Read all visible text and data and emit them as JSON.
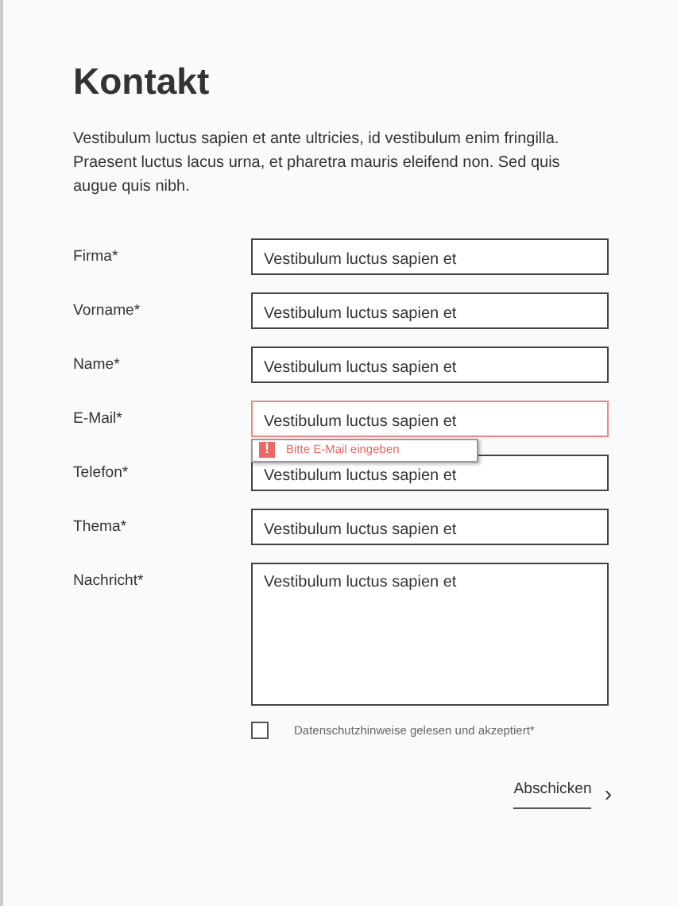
{
  "title": "Kontakt",
  "intro": "Vestibulum luctus sapien et ante ultricies, id vestibulum enim fringilla. Praesent luctus lacus urna, et pharetra mauris eleifend non. Sed quis augue quis nibh.",
  "fields": [
    {
      "label": "Firma*",
      "value": "Vestibulum luctus sapien et",
      "kind": "input",
      "invalid": false
    },
    {
      "label": "Vorname*",
      "value": "Vestibulum luctus sapien et",
      "kind": "input",
      "invalid": false
    },
    {
      "label": "Name*",
      "value": "Vestibulum luctus sapien et",
      "kind": "input",
      "invalid": false
    },
    {
      "label": "E-Mail*",
      "value": "Vestibulum luctus sapien et",
      "kind": "input",
      "invalid": true,
      "error": "Bitte E-Mail eingeben",
      "error_icon": "!"
    },
    {
      "label": "Telefon*",
      "value": "Vestibulum luctus sapien et",
      "kind": "input",
      "invalid": false
    },
    {
      "label": "Thema*",
      "value": "Vestibulum luctus sapien et",
      "kind": "input",
      "invalid": false
    },
    {
      "label": "Nachricht*",
      "value": "Vestibulum luctus sapien et",
      "kind": "textarea",
      "invalid": false
    }
  ],
  "consent": {
    "label": "Datenschutzhinweise gelesen und akzeptiert*",
    "checked": false
  },
  "submit": {
    "label": "Abschicken",
    "arrow": "›"
  }
}
